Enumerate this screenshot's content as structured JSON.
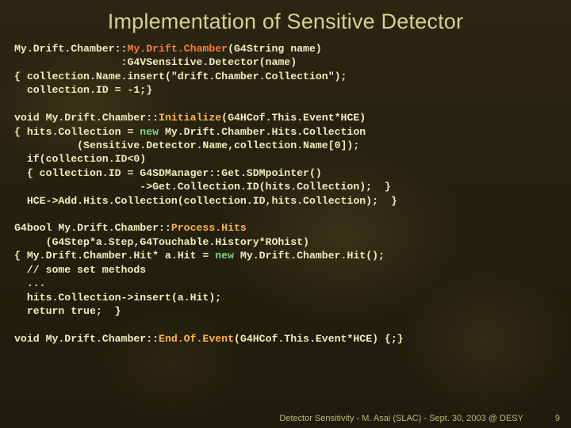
{
  "title": "Implementation of Sensitive Detector",
  "code": {
    "l01a": "My.Drift.Chamber::",
    "l01b": "My.Drift.Chamber",
    "l01c": "(G4String name)",
    "l02": "                 :G4VSensitive.Detector(name)",
    "l03": "{ collection.Name.insert(\"drift.Chamber.Collection\");",
    "l04": "  collection.ID = -1;}",
    "l06a": "void My.Drift.Chamber::",
    "l06b": "Initialize",
    "l06c": "(G4HCof.This.Event*HCE)",
    "l07a": "{ hits.Collection = ",
    "l07b": "new",
    "l07c": " My.Drift.Chamber.Hits.Collection",
    "l08": "          (Sensitive.Detector.Name,collection.Name[0]);",
    "l09": "  if(collection.ID<0)",
    "l10": "  { collection.ID = G4SDManager::Get.SDMpointer()",
    "l11": "                    ->Get.Collection.ID(hits.Collection);  }",
    "l12": "  HCE->Add.Hits.Collection(collection.ID,hits.Collection);  }",
    "l14a": "G4bool My.Drift.Chamber::",
    "l14b": "Process.Hits",
    "l15": "     (G4Step*a.Step,G4Touchable.History*ROhist)",
    "l16a": "{ My.Drift.Chamber.Hit* a.Hit = ",
    "l16b": "new",
    "l16c": " My.Drift.Chamber.Hit();",
    "l17": "  // some set methods",
    "l18": "  ...",
    "l19": "  hits.Collection->insert(a.Hit);",
    "l20": "  return true;  }",
    "l22a": "void My.Drift.Chamber::",
    "l22b": "End.Of.Event",
    "l22c": "(G4HCof.This.Event*HCE) {;}"
  },
  "footer": {
    "text": "Detector Sensitivity - M. Asai (SLAC) - Sept. 30, 2003 @ DESY",
    "page": "9"
  }
}
